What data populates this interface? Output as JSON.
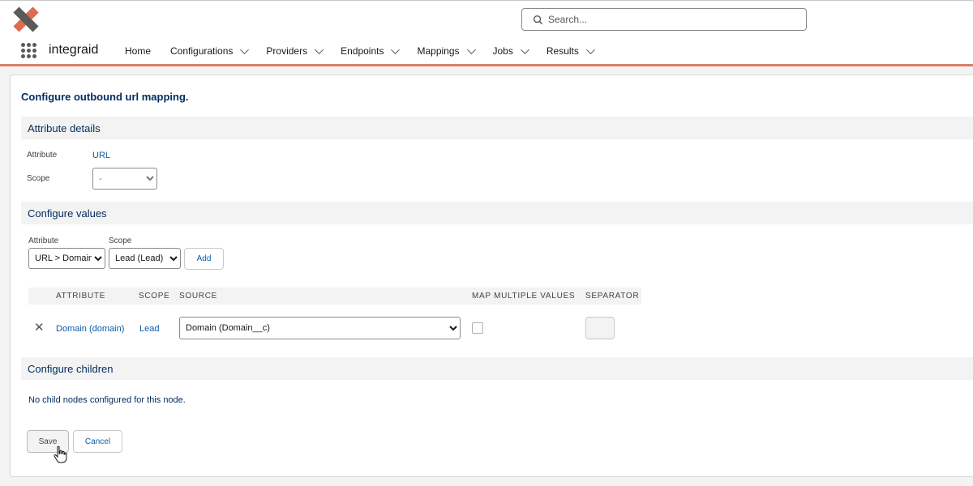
{
  "header": {
    "app_name": "integraid",
    "search_placeholder": "Search...",
    "nav": [
      {
        "label": "Home"
      },
      {
        "label": "Configurations"
      },
      {
        "label": "Providers"
      },
      {
        "label": "Endpoints"
      },
      {
        "label": "Mappings"
      },
      {
        "label": "Jobs"
      },
      {
        "label": "Results"
      }
    ]
  },
  "page": {
    "title": "Configure outbound url mapping."
  },
  "attribute_details": {
    "heading": "Attribute details",
    "attribute_label": "Attribute",
    "attribute_value": "URL",
    "scope_label": "Scope",
    "scope_value": "-"
  },
  "configure_values": {
    "heading": "Configure values",
    "attribute_label": "Attribute",
    "attribute_value": "URL > Domain",
    "scope_label": "Scope",
    "scope_value": "Lead (Lead)",
    "add_label": "Add",
    "table": {
      "headers": [
        "ATTRIBUTE",
        "SCOPE",
        "SOURCE",
        "MAP MULTIPLE VALUES",
        "SEPARATOR"
      ],
      "rows": [
        {
          "attribute": "Domain (domain)",
          "scope": "Lead",
          "source": "Domain (Domain__c)",
          "map_multiple": false,
          "separator": ""
        }
      ]
    }
  },
  "configure_children": {
    "heading": "Configure children",
    "empty_text": "No child nodes configured for this node."
  },
  "footer": {
    "save_label": "Save",
    "cancel_label": "Cancel"
  },
  "colors": {
    "accent_border": "#d9826a",
    "heading_blue": "#032d60",
    "link_blue": "#0b5cab"
  }
}
